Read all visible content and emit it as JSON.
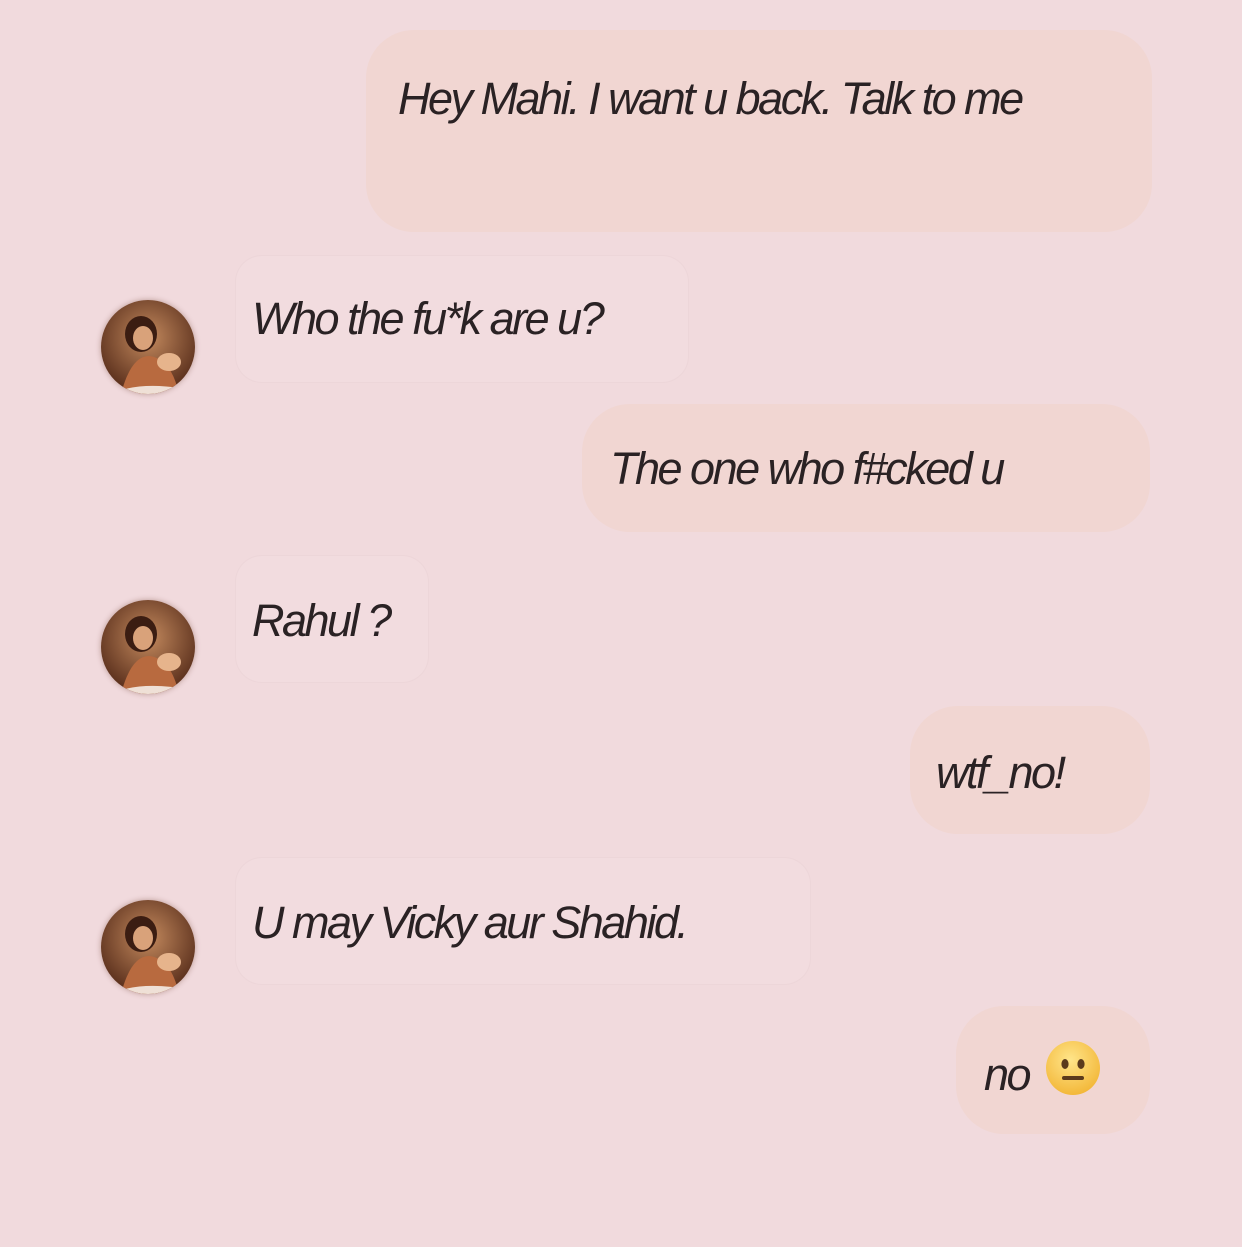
{
  "colors": {
    "background": "#f1dadd",
    "outgoing_bubble": "#f1d6d2",
    "incoming_bubble": "#f2dcdf",
    "text": "#2a2224"
  },
  "messages": [
    {
      "direction": "outgoing",
      "text": "Hey Mahi. I want u back. Talk to me"
    },
    {
      "direction": "incoming",
      "text": "Who the fu*k are u?",
      "avatar": "profile-photo"
    },
    {
      "direction": "outgoing",
      "text": "The one who f#cked u"
    },
    {
      "direction": "incoming",
      "text": "Rahul ?",
      "avatar": "profile-photo"
    },
    {
      "direction": "outgoing",
      "text": "wtf_no!"
    },
    {
      "direction": "incoming",
      "text": "U may Vicky aur Shahid.",
      "avatar": "profile-photo"
    },
    {
      "direction": "outgoing",
      "text": "no",
      "emoji": "neutral-face-emoji"
    }
  ]
}
